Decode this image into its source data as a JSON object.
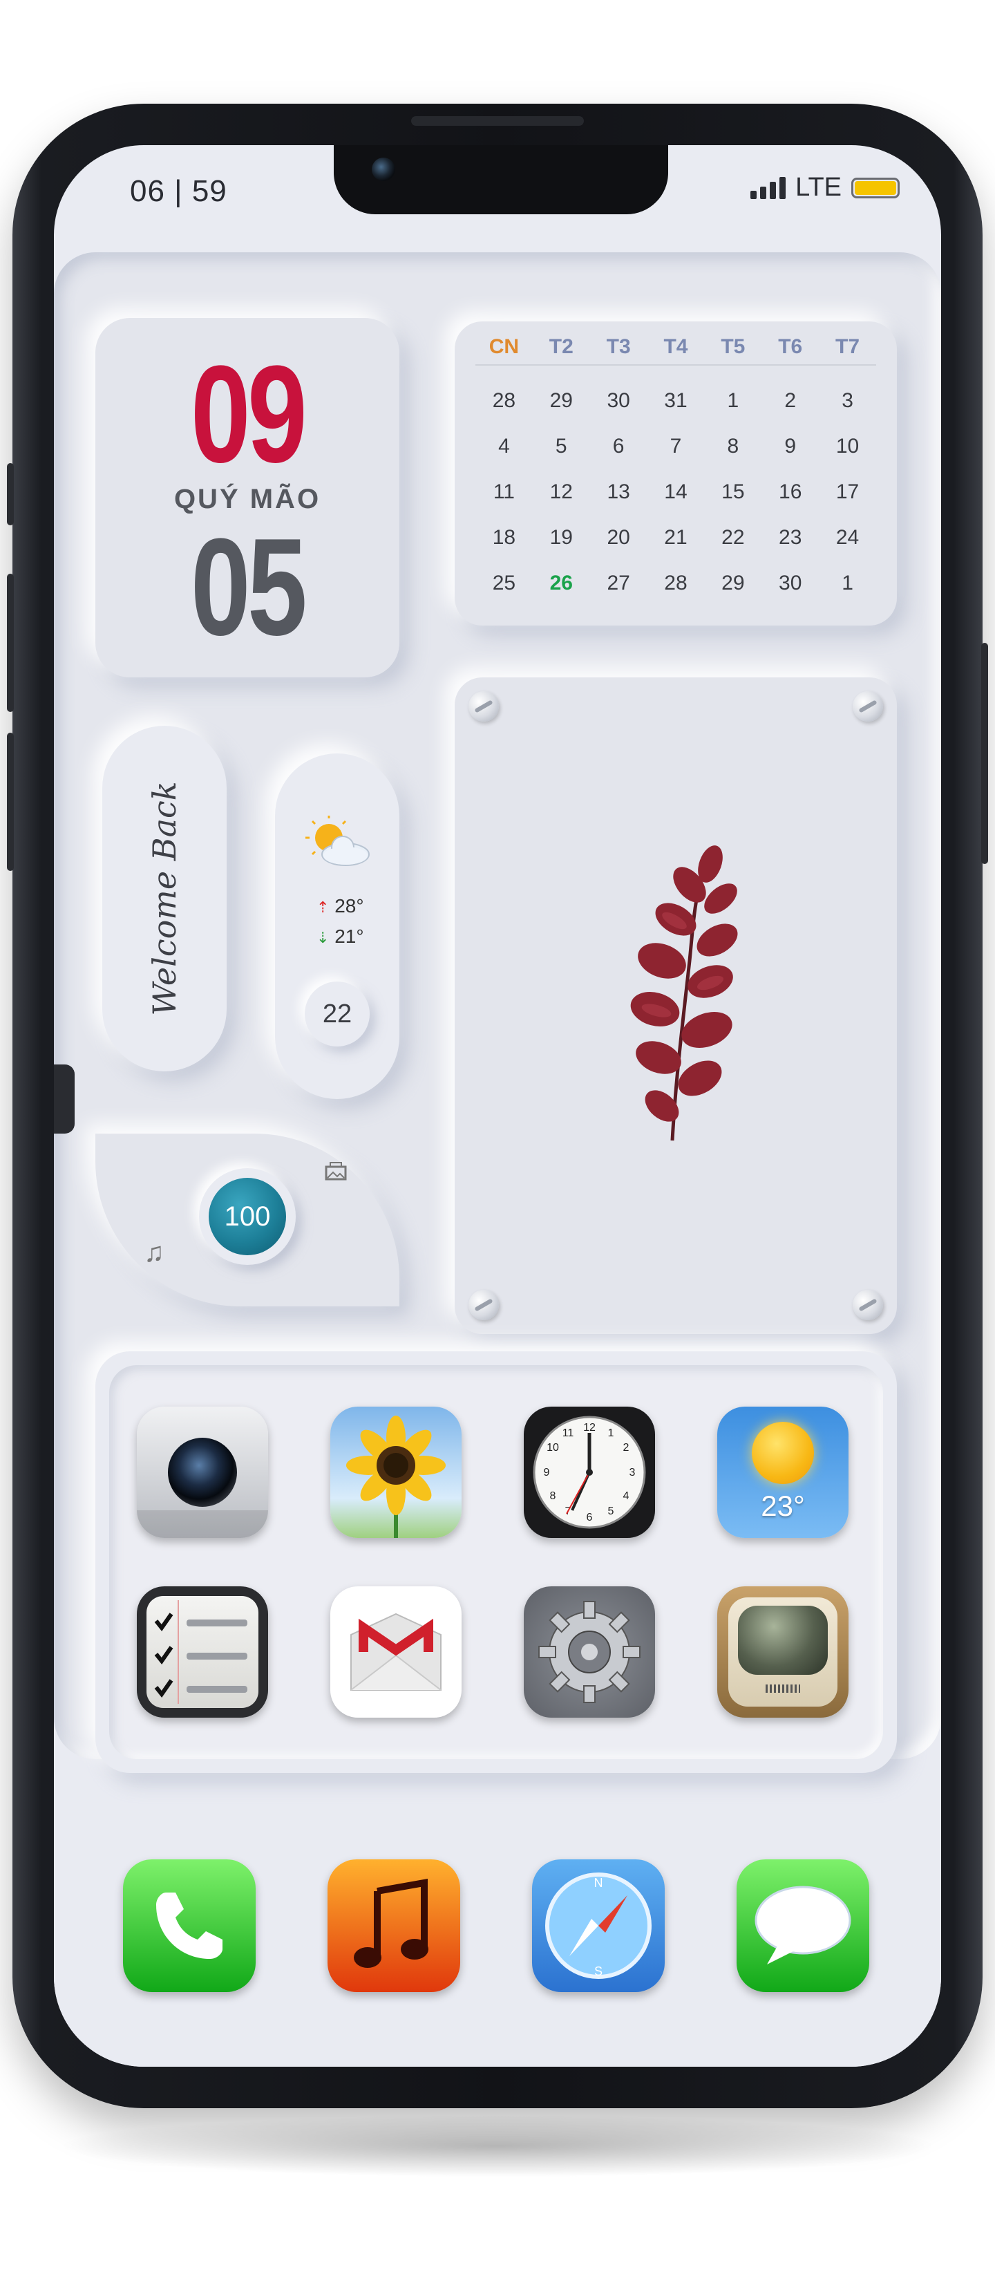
{
  "status_bar": {
    "time": "06 | 59",
    "network": "LTE",
    "battery_color": "#f5c400"
  },
  "date_widget": {
    "day": "09",
    "lunar_label": "QUÝ MÃO",
    "month": "05",
    "day_color": "#c8123c",
    "month_color": "#55585f"
  },
  "calendar": {
    "headers": [
      "CN",
      "T2",
      "T3",
      "T4",
      "T5",
      "T6",
      "T7"
    ],
    "days": [
      "28",
      "29",
      "30",
      "31",
      "1",
      "2",
      "3",
      "4",
      "5",
      "6",
      "7",
      "8",
      "9",
      "10",
      "11",
      "12",
      "13",
      "14",
      "15",
      "16",
      "17",
      "18",
      "19",
      "20",
      "21",
      "22",
      "23",
      "24",
      "25",
      "26",
      "27",
      "28",
      "29",
      "30",
      "1"
    ],
    "today": "26"
  },
  "welcome_widget": {
    "text": "Welcome Back"
  },
  "weather_widget": {
    "icon": "sun-cloud-icon",
    "high": "28°",
    "low": "21°",
    "day": "22"
  },
  "battery_widget": {
    "value": "100",
    "left_icon": "music-note-icon",
    "right_icon": "photo-icon"
  },
  "photo_frame": {
    "image": "red-leaf-branch"
  },
  "apps": [
    {
      "name": "Camera",
      "icon": "camera-icon"
    },
    {
      "name": "Photos",
      "icon": "sunflower-icon"
    },
    {
      "name": "Clock",
      "icon": "clock-icon"
    },
    {
      "name": "Weather",
      "icon": "weather-sun-icon",
      "label": "23°"
    },
    {
      "name": "Reminders",
      "icon": "checklist-icon"
    },
    {
      "name": "Gmail",
      "icon": "gmail-envelope-icon"
    },
    {
      "name": "Settings",
      "icon": "gear-icon"
    },
    {
      "name": "YouTube",
      "icon": "retro-tv-icon"
    }
  ],
  "dock": [
    {
      "name": "Phone",
      "icon": "phone-icon"
    },
    {
      "name": "Music",
      "icon": "music-icon"
    },
    {
      "name": "Safari",
      "icon": "compass-icon"
    },
    {
      "name": "Messages",
      "icon": "speech-bubble-icon"
    }
  ]
}
